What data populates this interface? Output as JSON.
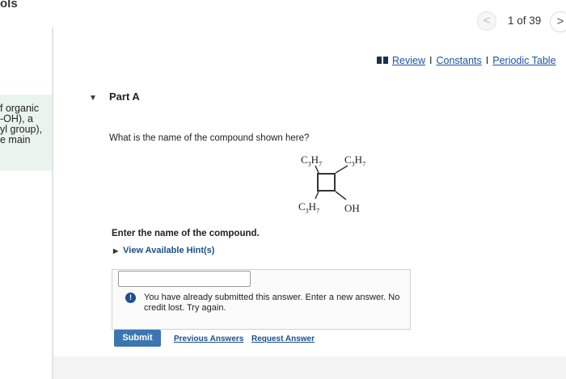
{
  "sidebar": {
    "title": "ols",
    "text_lines": [
      "f organic",
      "-OH), a",
      "yl group),",
      "e main"
    ]
  },
  "nav": {
    "prev_label": "<",
    "count": "1 of 39",
    "next_label": ">"
  },
  "resources": {
    "review": "Review",
    "separator": "I",
    "constants": "Constants",
    "periodic_table": "Periodic Table"
  },
  "part": {
    "title": "Part A"
  },
  "question": {
    "text": "What is the name of the compound shown here?",
    "molecule_labels": {
      "top_left": {
        "base": "C",
        "sub1": "3",
        "mid": "H",
        "sub2": "7"
      },
      "top_right": {
        "base": "C",
        "sub1": "3",
        "mid": "H",
        "sub2": "7"
      },
      "bottom_left": {
        "base": "C",
        "sub1": "3",
        "mid": "H",
        "sub2": "7"
      },
      "bottom_right": "OH"
    }
  },
  "answer": {
    "instruction": "Enter the name of the compound.",
    "hint_link": "View Available Hint(s)",
    "input_value": "",
    "feedback_icon": "!",
    "feedback_text": "You have already submitted this answer. Enter a new answer. No credit lost. Try again.",
    "submit_label": "Submit",
    "previous_answers_label": "Previous Answers",
    "request_answer_label": "Request Answer"
  }
}
